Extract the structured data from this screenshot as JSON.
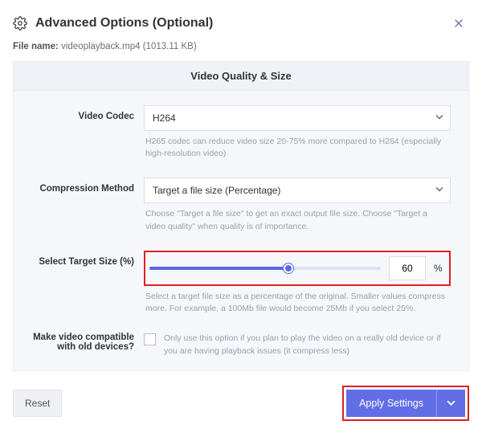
{
  "header": {
    "title": "Advanced Options (Optional)"
  },
  "file": {
    "label": "File name:",
    "name": "videoplayback.mp4 (1013.11 KB)"
  },
  "panel": {
    "title": "Video Quality & Size",
    "codec": {
      "label": "Video Codec",
      "value": "H264",
      "help": "H265 codec can reduce video size 20-75% more compared to H264 (especially high-resolution video)"
    },
    "compression": {
      "label": "Compression Method",
      "value": "Target a file size (Percentage)",
      "help": "Choose \"Target a file size\" to get an exact output file size. Choose \"Target a video quality\" when quality is of importance."
    },
    "target": {
      "label": "Select Target Size (%)",
      "value": "60",
      "unit": "%",
      "percent": 60,
      "help": "Select a target file size as a percentage of the original. Smaller values compress more. For example, a 100Mb file would become 25Mb if you select 25%."
    },
    "compat": {
      "label": "Make video compatible with old devices?",
      "text": "Only use this option if you plan to play the video on a really old device or if you are having playback issues (it compress less)"
    }
  },
  "footer": {
    "reset": "Reset",
    "apply": "Apply Settings"
  }
}
